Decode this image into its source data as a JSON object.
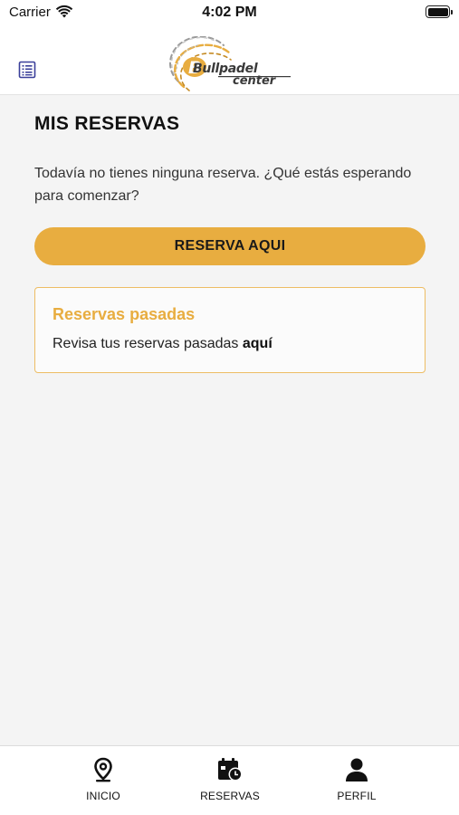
{
  "status_bar": {
    "carrier": "Carrier",
    "time": "4:02 PM",
    "icons": [
      "wifi-icon",
      "battery-icon"
    ]
  },
  "header": {
    "menu_icon": "list-icon",
    "logo_text_line1": "Bullpadel",
    "logo_text_line2": "center"
  },
  "main": {
    "title": "MIS RESERVAS",
    "empty_message": "Todavía no tienes ninguna reserva. ¿Qué estás esperando para comenzar?",
    "reserve_button_label": "RESERVA AQUI",
    "past_card": {
      "title": "Reservas pasadas",
      "text": "Revisa tus reservas pasadas ",
      "link": "aquí"
    }
  },
  "tab_bar": {
    "tabs": [
      {
        "label": "INICIO",
        "icon": "location-pin-icon"
      },
      {
        "label": "RESERVAS",
        "icon": "calendar-clock-icon"
      },
      {
        "label": "PERFIL",
        "icon": "user-icon"
      }
    ]
  },
  "colors": {
    "accent": "#e8ad40",
    "card_border": "#edbd64",
    "background": "#f4f4f4"
  }
}
